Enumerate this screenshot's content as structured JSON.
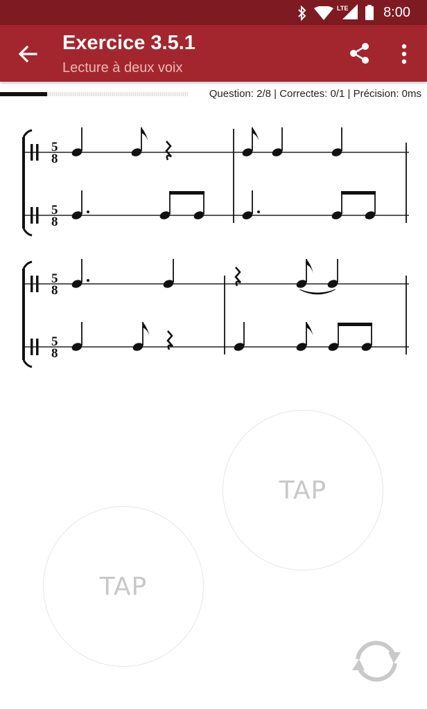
{
  "status_bar": {
    "time": "8:00",
    "icons": [
      "bluetooth-icon",
      "wifi-icon",
      "lte-signal-icon",
      "battery-icon"
    ],
    "network_label": "LTE"
  },
  "app_bar": {
    "title": "Exercice 3.5.1",
    "subtitle": "Lecture à deux voix",
    "color": "#a3262e",
    "status_color": "#7e1b22",
    "icons": [
      "back-arrow-icon",
      "share-icon",
      "more-vert-icon"
    ]
  },
  "progress": {
    "fraction": 0.25,
    "stats_text": "Question: 2/8 | Correctes: 0/1 | Précision: 0ms"
  },
  "score": {
    "time_signature": [
      "5",
      "8"
    ],
    "systems": 2,
    "voices_per_system": 2
  },
  "tap_buttons": [
    {
      "label": "TAP"
    },
    {
      "label": "TAP"
    }
  ],
  "reload_icon": "refresh-icon"
}
